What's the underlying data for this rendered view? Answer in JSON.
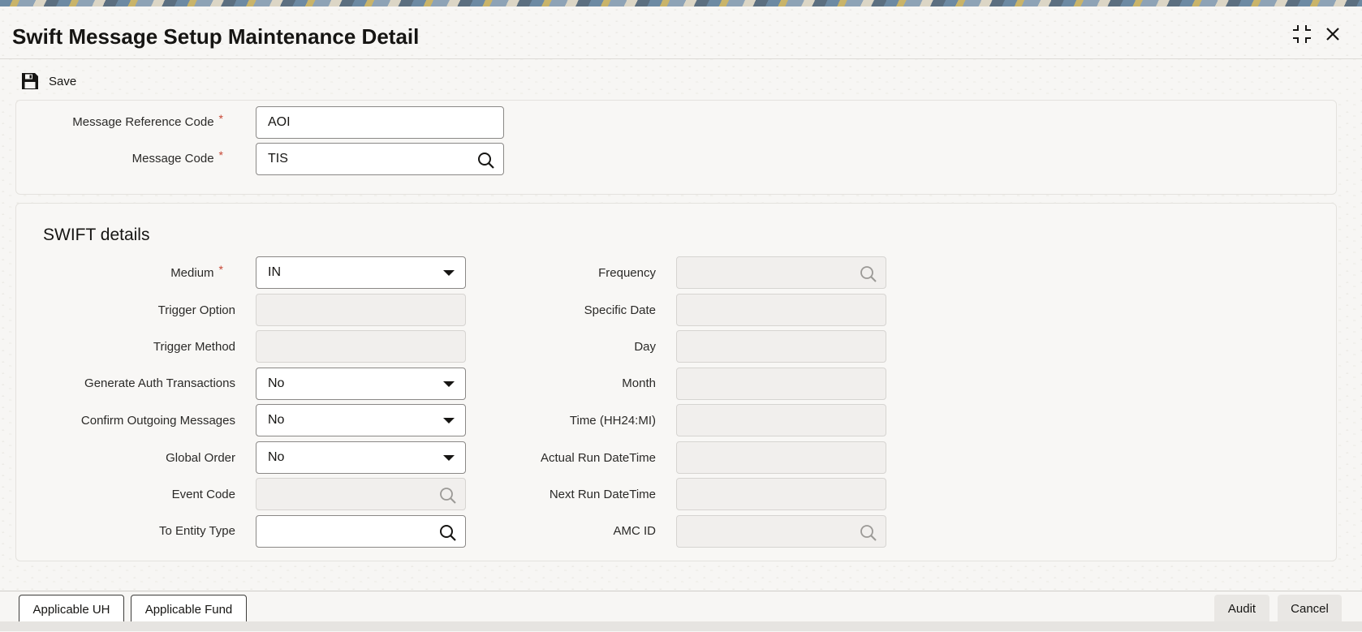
{
  "window": {
    "title": "Swift Message Setup Maintenance Detail"
  },
  "toolbar": {
    "save_label": "Save"
  },
  "header_fields": {
    "message_reference_code": {
      "label": "Message Reference Code",
      "required": "*",
      "value": "AOI"
    },
    "message_code": {
      "label": "Message Code",
      "required": "*",
      "value": "TIS"
    }
  },
  "swift_details": {
    "title": "SWIFT details",
    "left": {
      "medium": {
        "label": "Medium",
        "required": "*",
        "value": "IN"
      },
      "trigger_option": {
        "label": "Trigger Option",
        "value": ""
      },
      "trigger_method": {
        "label": "Trigger Method",
        "value": ""
      },
      "generate_auth_transactions": {
        "label": "Generate Auth Transactions",
        "value": "No"
      },
      "confirm_outgoing_messages": {
        "label": "Confirm Outgoing Messages",
        "value": "No"
      },
      "global_order": {
        "label": "Global Order",
        "value": "No"
      },
      "event_code": {
        "label": "Event Code",
        "value": ""
      },
      "to_entity_type": {
        "label": "To Entity Type",
        "value": ""
      }
    },
    "right": {
      "frequency": {
        "label": "Frequency",
        "value": ""
      },
      "specific_date": {
        "label": "Specific Date",
        "value": ""
      },
      "day": {
        "label": "Day",
        "value": ""
      },
      "month": {
        "label": "Month",
        "value": ""
      },
      "time": {
        "label": "Time (HH24:MI)",
        "value": ""
      },
      "actual_run_datetime": {
        "label": "Actual Run DateTime",
        "value": ""
      },
      "next_run_datetime": {
        "label": "Next Run DateTime",
        "value": ""
      },
      "amc_id": {
        "label": "AMC ID",
        "value": ""
      }
    }
  },
  "footer": {
    "applicable_uh": "Applicable UH",
    "applicable_fund": "Applicable Fund",
    "audit": "Audit",
    "cancel": "Cancel"
  },
  "icons": {
    "save": "save-icon",
    "restore": "restore-window-icon",
    "close": "close-icon",
    "search": "search-icon",
    "dropdown": "chevron-down-icon"
  }
}
